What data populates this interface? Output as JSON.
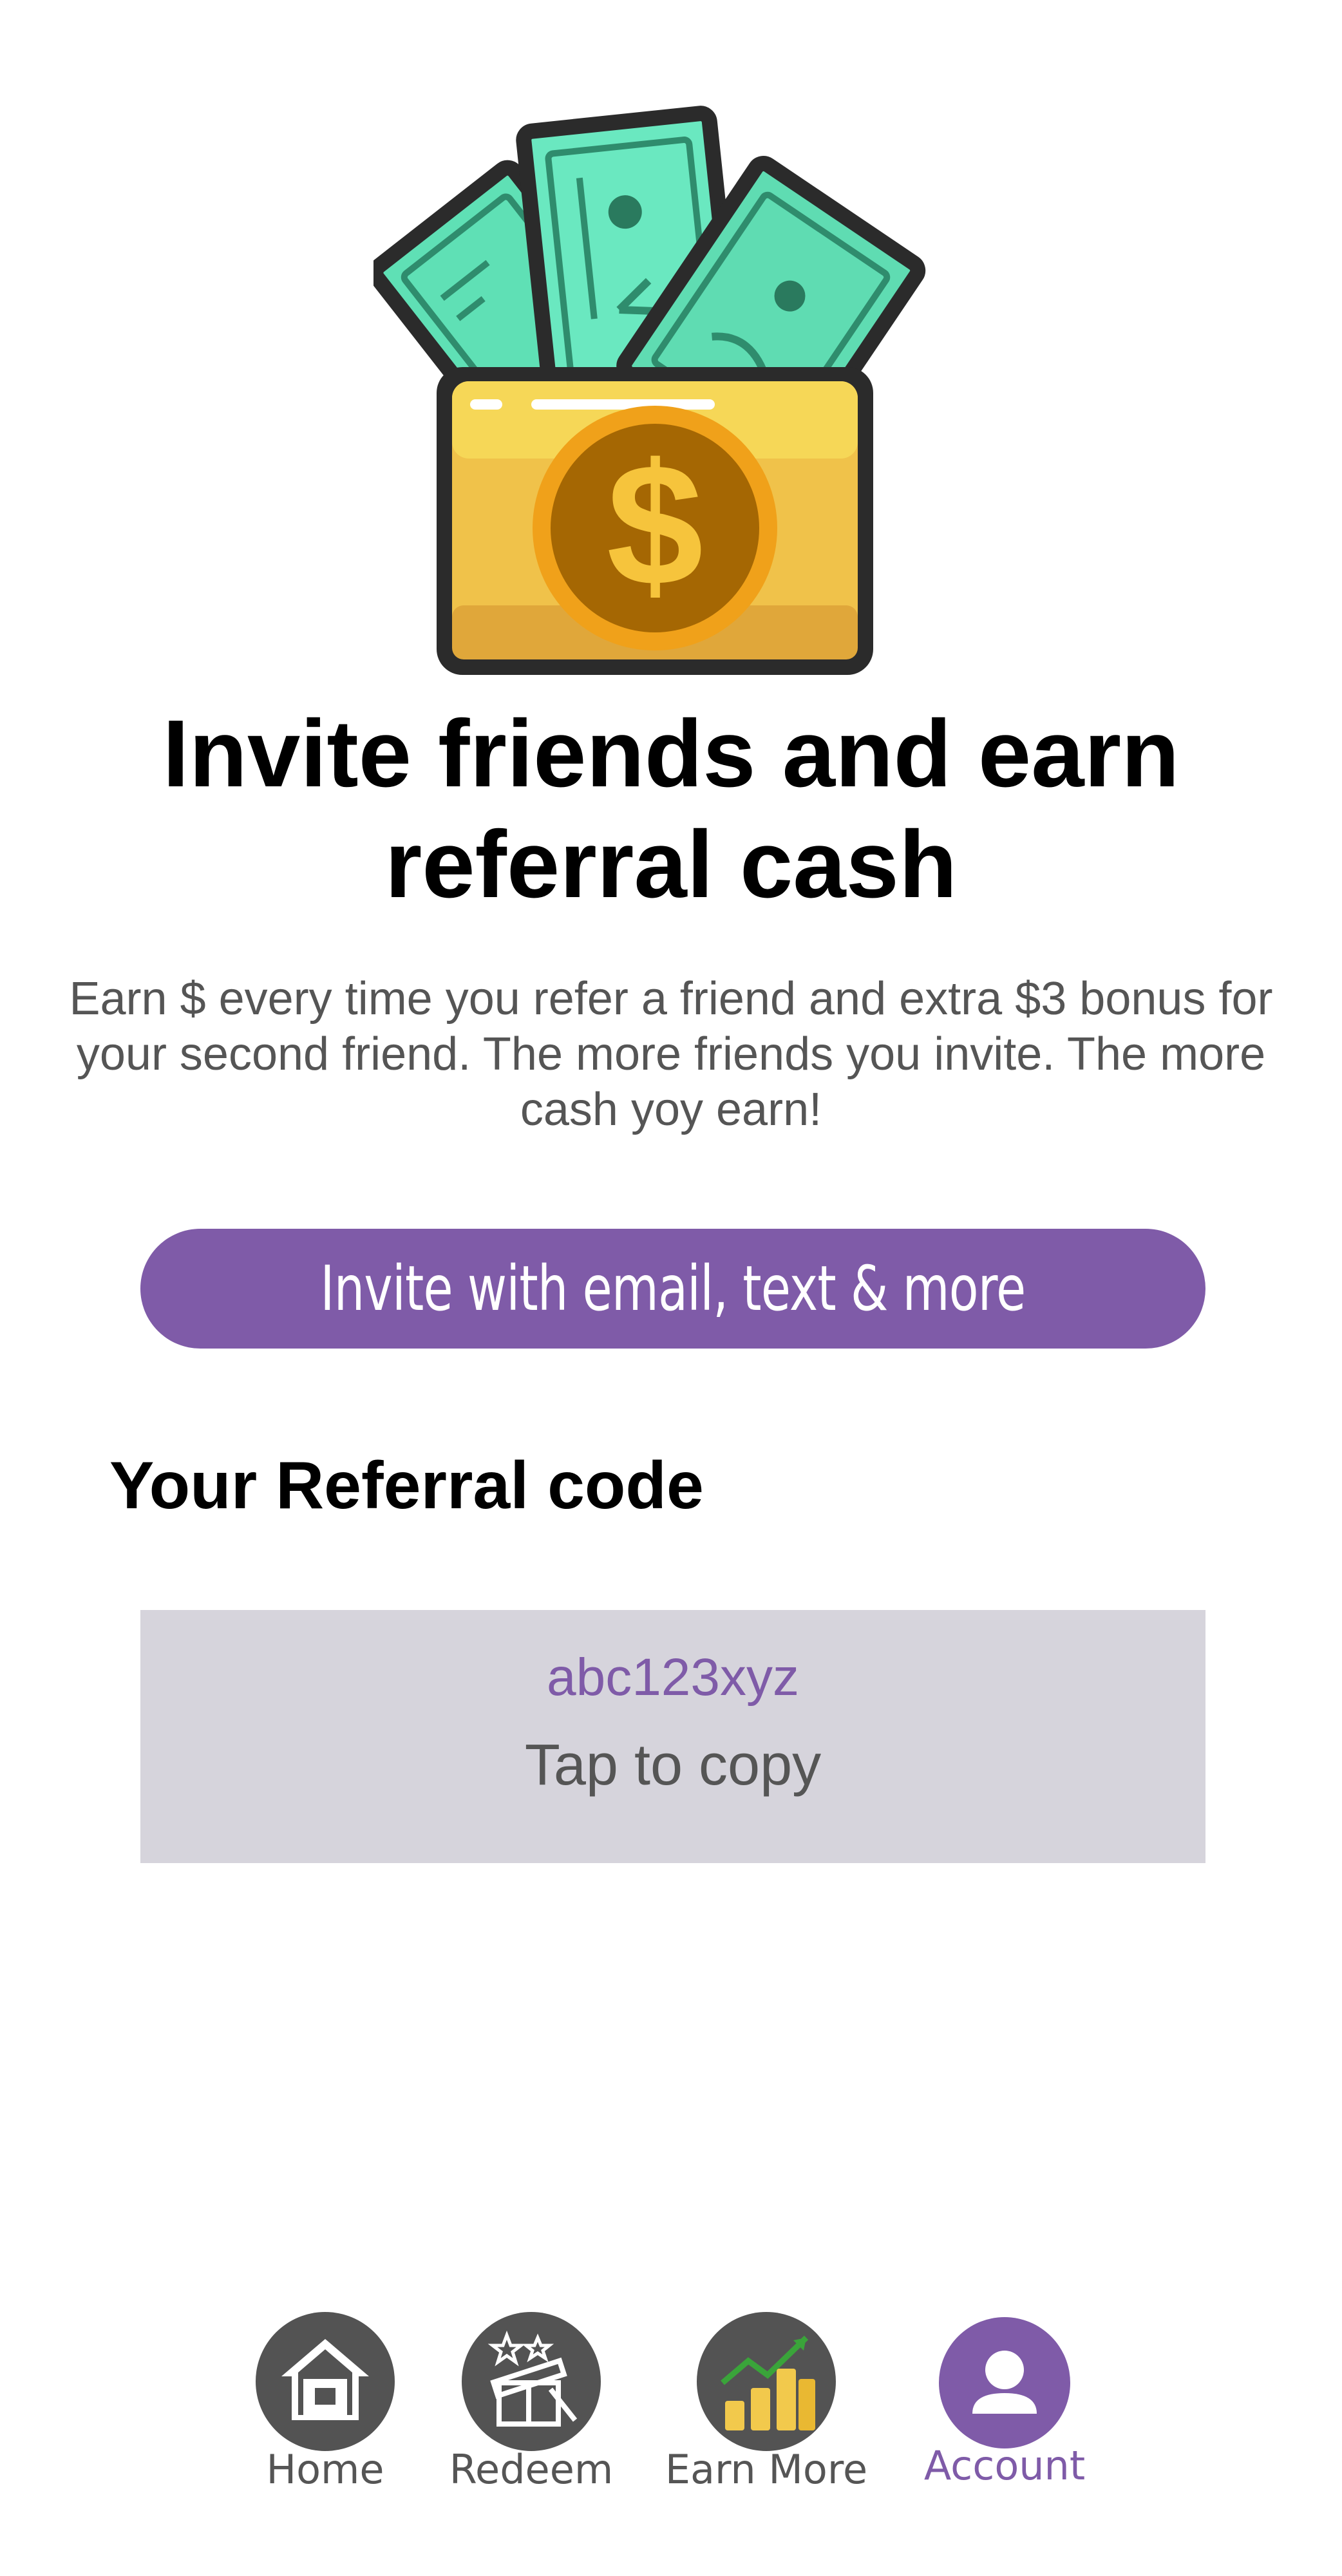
{
  "hero": {
    "title": "Invite friends and earn referral cash",
    "description": "Earn $ every time you refer a friend and extra $3 bonus for your second friend. The more friends you invite. The more cash yoy earn!",
    "icon": "money-wallet-icon"
  },
  "invite": {
    "button_label": "Invite with email, text & more"
  },
  "referral": {
    "section_label": "Your Referral code",
    "code": "abc123xyz",
    "copy_hint": "Tap to copy"
  },
  "nav": {
    "items": [
      {
        "label": "Home",
        "icon": "home-icon",
        "active": false
      },
      {
        "label": "Redeem",
        "icon": "gift-icon",
        "active": false
      },
      {
        "label": "Earn More",
        "icon": "coins-growth-icon",
        "active": false
      },
      {
        "label": "Account",
        "icon": "user-icon",
        "active": true
      }
    ]
  },
  "colors": {
    "accent": "#7f5ba8",
    "nav_inactive": "#535353",
    "code_box_bg": "#d6d4dc",
    "body_text": "#555555"
  }
}
